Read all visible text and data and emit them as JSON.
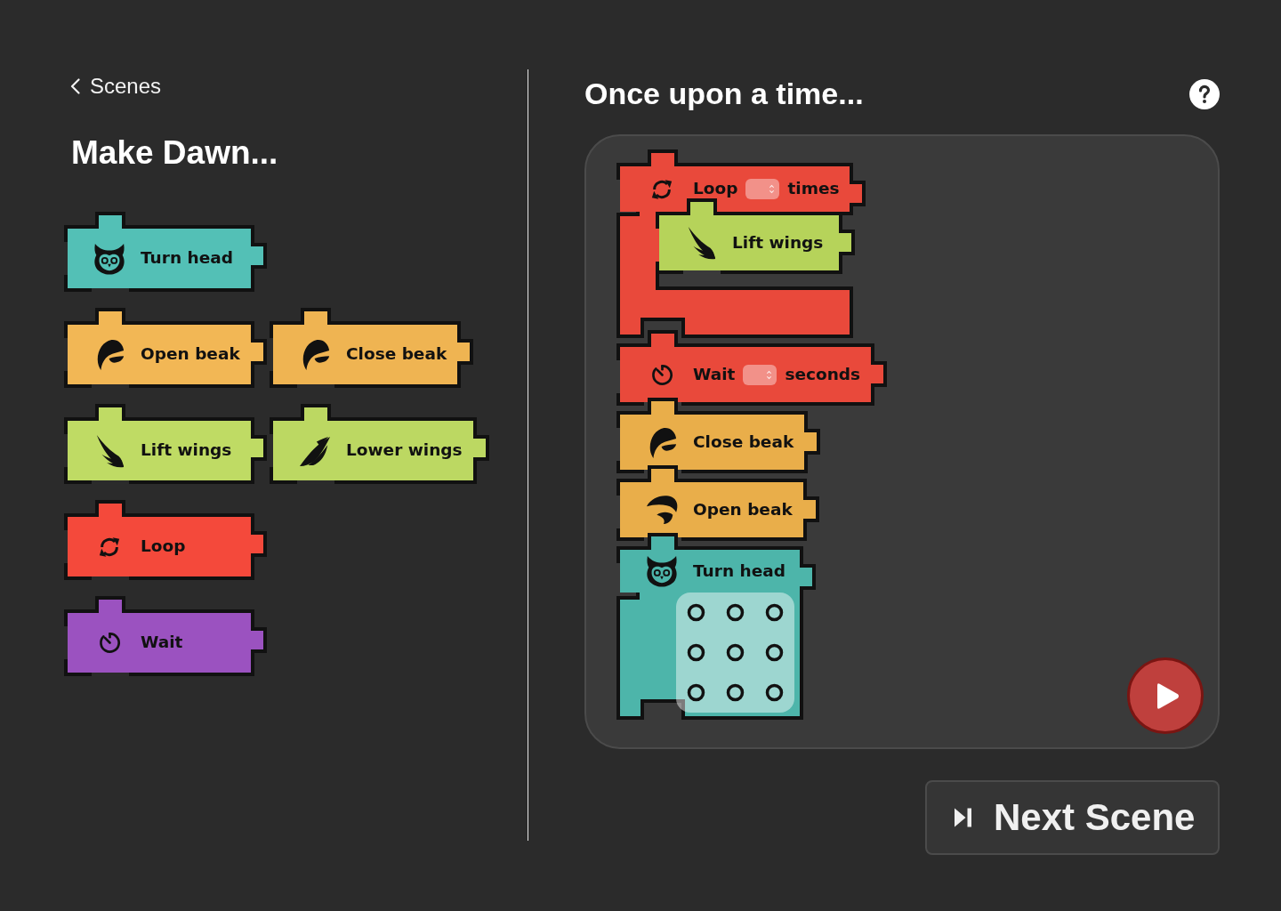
{
  "scene": {
    "back_link": "Scenes",
    "title": "Make Dawn...",
    "palette": [
      [
        {
          "kind": "turn",
          "label": "Turn head",
          "color": "#53c0b6"
        }
      ],
      [
        {
          "kind": "open",
          "label": "Open beak",
          "color": "#f2b755"
        },
        {
          "kind": "close",
          "label": "Close beak",
          "color": "#efb452"
        }
      ],
      [
        {
          "kind": "lift",
          "label": "Lift wings",
          "color": "#bfdb64"
        },
        {
          "kind": "lower",
          "label": "Lower wings",
          "color": "#bcd862"
        }
      ],
      [
        {
          "kind": "loop",
          "label": "Loop",
          "color": "#f4493b"
        }
      ],
      [
        {
          "kind": "wait",
          "label": "Wait",
          "color": "#9b52c0"
        }
      ]
    ]
  },
  "story": {
    "title": "Once upon a time...",
    "blocks": [
      {
        "kind": "loop",
        "color": "#e9493b",
        "parts": [
          {
            "kind": "text",
            "text": "Loop"
          },
          {
            "kind": "field"
          },
          {
            "kind": "text",
            "text": "times"
          }
        ],
        "children": [
          {
            "kind": "lift",
            "color": "#b6d35a",
            "parts": [
              {
                "kind": "text",
                "text": "Lift wings"
              }
            ]
          }
        ]
      },
      {
        "kind": "wait",
        "color": "#e9493b",
        "parts": [
          {
            "kind": "text",
            "text": "Wait"
          },
          {
            "kind": "field"
          },
          {
            "kind": "text",
            "text": "seconds"
          }
        ]
      },
      {
        "kind": "close",
        "color": "#e9ae4a",
        "parts": [
          {
            "kind": "text",
            "text": "Close beak"
          }
        ]
      },
      {
        "kind": "open",
        "color": "#e9ae4a",
        "parts": [
          {
            "kind": "text",
            "text": "Open beak"
          }
        ]
      },
      {
        "kind": "turn",
        "color": "#4db5aa",
        "parts": [
          {
            "kind": "text",
            "text": "Turn head"
          }
        ],
        "grid": [
          {
            "selected": false
          },
          {
            "selected": false
          },
          {
            "selected": false
          },
          {
            "selected": false
          },
          {
            "selected": false
          },
          {
            "selected": false
          },
          {
            "selected": false
          },
          {
            "selected": false
          },
          {
            "selected": false
          }
        ]
      }
    ]
  },
  "next_button": "Next Scene"
}
